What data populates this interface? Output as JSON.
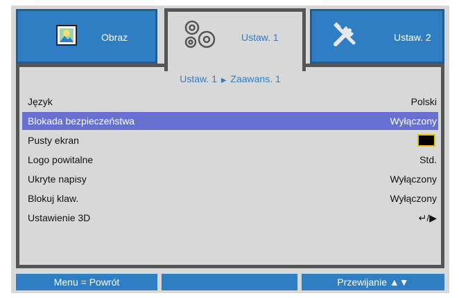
{
  "tabs": [
    {
      "label": "Obraz",
      "icon": "picture-icon"
    },
    {
      "label": "Ustaw. 1",
      "icon": "gears-icon"
    },
    {
      "label": "Ustaw. 2",
      "icon": "tools-icon"
    }
  ],
  "breadcrumb": {
    "part1": "Ustaw. 1",
    "arrow": "▶",
    "part2": "Zaawans. 1"
  },
  "menu": [
    {
      "name": "Język",
      "value": "Polski"
    },
    {
      "name": "Blokada bezpieczeństwa",
      "value": "Wyłączony"
    },
    {
      "name": "Pusty ekran",
      "value": ""
    },
    {
      "name": "Logo powitalne",
      "value": "Std."
    },
    {
      "name": "Ukryte napisy",
      "value": "Wyłączony"
    },
    {
      "name": "Blokuj klaw.",
      "value": "Wyłączony"
    },
    {
      "name": "Ustawienie 3D",
      "value": "↵/▶"
    }
  ],
  "footer": {
    "left": "Menu = Powrót",
    "middle": "",
    "right": "Przewijanie ▲▼"
  },
  "colors": {
    "tab_blue": "#2f7ec4",
    "selected_row": "#6670cf",
    "panel_bg": "#d8d8d8",
    "border": "#555555"
  }
}
